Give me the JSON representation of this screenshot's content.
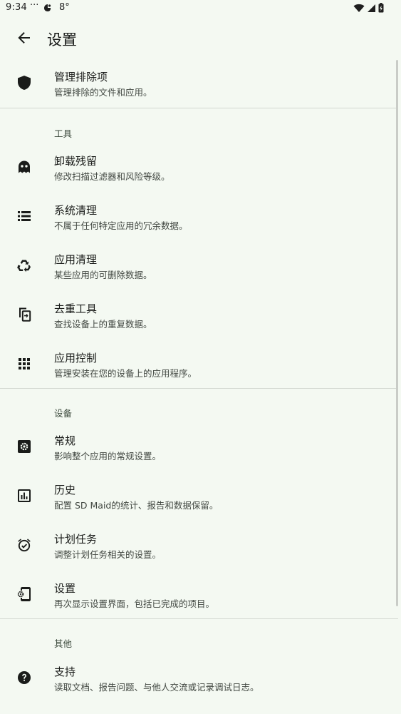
{
  "status_bar": {
    "time": "9:34",
    "dots": "···",
    "temperature": "8°",
    "icons": [
      "app-notification-icon",
      "wifi-icon",
      "signal-icon",
      "battery-icon"
    ]
  },
  "app_bar": {
    "title": "设置",
    "back_icon": "arrow-back-icon"
  },
  "colors": {
    "background": "#f4f9f2",
    "text_primary": "#1a1c1a",
    "text_secondary": "#424842",
    "divider": "#d3d8d1"
  },
  "sections": {
    "exclusions": {
      "title": "管理排除项",
      "summary": "管理排除的文件和应用。",
      "icon": "shield-icon"
    },
    "tools": {
      "header": "工具",
      "items": [
        {
          "title": "卸载残留",
          "summary": "修改扫描过滤器和风险等级。",
          "icon": "ghost-icon"
        },
        {
          "title": "系统清理",
          "summary": "不属于任何特定应用的冗余数据。",
          "icon": "list-icon"
        },
        {
          "title": "应用清理",
          "summary": "某些应用的可删除数据。",
          "icon": "recycle-icon"
        },
        {
          "title": "去重工具",
          "summary": "查找设备上的重复数据。",
          "icon": "duplicate-icon"
        },
        {
          "title": "应用控制",
          "summary": "管理安装在您的设备上的应用程序。",
          "icon": "apps-grid-icon"
        }
      ]
    },
    "device": {
      "header": "设备",
      "items": [
        {
          "title": "常规",
          "summary": "影响整个应用的常规设置。",
          "icon": "settings-box-icon"
        },
        {
          "title": "历史",
          "summary": "配置 SD Maid的统计、报告和数据保留。",
          "icon": "chart-icon"
        },
        {
          "title": "计划任务",
          "summary": "调整计划任务相关的设置。",
          "icon": "alarm-icon"
        },
        {
          "title": "设置",
          "summary": "再次显示设置界面，包括已完成的项目。",
          "icon": "phone-setup-icon"
        }
      ]
    },
    "other": {
      "header": "其他",
      "items": [
        {
          "title": "支持",
          "summary": "读取文档、报告问题、与他人交流或记录调试日志。",
          "icon": "help-icon"
        }
      ]
    }
  }
}
